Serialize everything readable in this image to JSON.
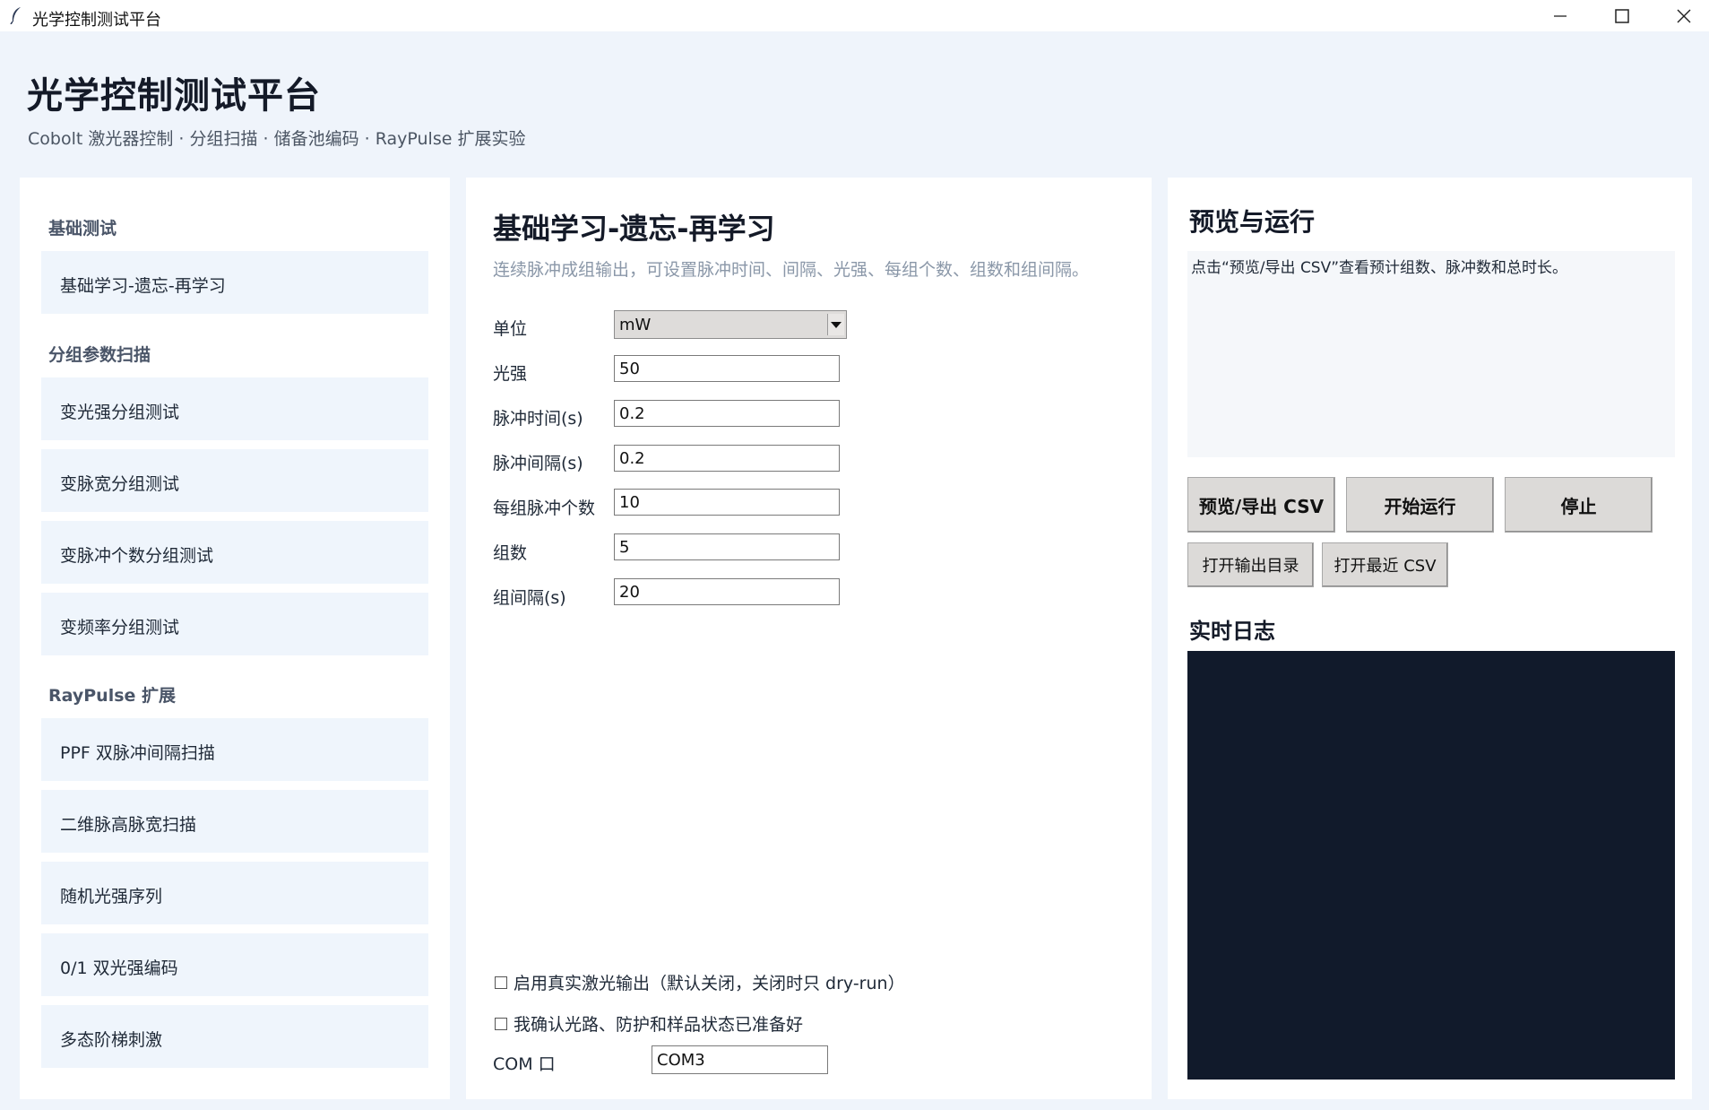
{
  "window": {
    "title": "光学控制测试平台",
    "controls": [
      "minimize-icon",
      "maximize-icon",
      "close-icon"
    ]
  },
  "header": {
    "title": "光学控制测试平台",
    "subtitle": "Cobolt 激光器控制 · 分组扫描 · 储备池编码 · RayPulse 扩展实验"
  },
  "sidebar": {
    "sections": [
      {
        "label": "基础测试",
        "items": [
          "基础学习-遗忘-再学习"
        ]
      },
      {
        "label": "分组参数扫描",
        "items": [
          "变光强分组测试",
          "变脉宽分组测试",
          "变脉冲个数分组测试",
          "变频率分组测试"
        ]
      },
      {
        "label": "RayPulse 扩展",
        "items": [
          "PPF 双脉冲间隔扫描",
          "二维脉高脉宽扫描",
          "随机光强序列",
          "0/1 双光强编码",
          "多态阶梯刺激"
        ]
      }
    ]
  },
  "main": {
    "title": "基础学习-遗忘-再学习",
    "description": "连续脉冲成组输出，可设置脉冲时间、间隔、光强、每组个数、组数和组间隔。",
    "unit": {
      "label": "单位",
      "value": "mW"
    },
    "fields": [
      {
        "label": "光强",
        "value": "50"
      },
      {
        "label": "脉冲时间(s)",
        "value": "0.2"
      },
      {
        "label": "脉冲间隔(s)",
        "value": "0.2"
      },
      {
        "label": "每组脉冲个数",
        "value": "10"
      },
      {
        "label": "组数",
        "value": "5"
      },
      {
        "label": "组间隔(s)",
        "value": "20"
      }
    ],
    "checkboxes": [
      {
        "label": "启用真实激光输出（默认关闭，关闭时只 dry-run）",
        "checked": false
      },
      {
        "label": "我确认光路、防护和样品状态已准备好",
        "checked": false
      }
    ],
    "com": {
      "label": "COM 口",
      "value": "COM3"
    }
  },
  "right": {
    "title": "预览与运行",
    "preview_text": "点击“预览/导出 CSV”查看预计组数、脉冲数和总时长。",
    "buttons": {
      "preview": "预览/导出 CSV",
      "start": "开始运行",
      "stop": "停止",
      "open_dir": "打开输出目录",
      "open_recent": "打开最近 CSV"
    },
    "log_title": "实时日志",
    "log_background": "#111a2b"
  }
}
